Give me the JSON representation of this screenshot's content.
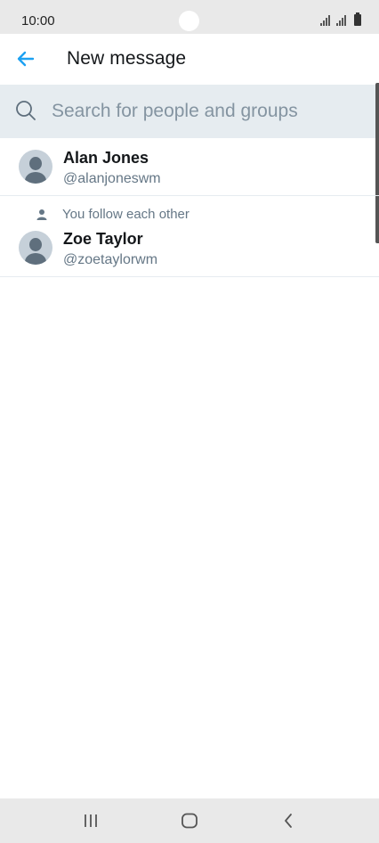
{
  "status_bar": {
    "time": "10:00",
    "icons": [
      "signal-icon",
      "signal-icon",
      "battery-icon"
    ]
  },
  "header": {
    "back_icon": "arrow-left-icon",
    "title": "New message",
    "accent_color": "#1da1f2"
  },
  "search": {
    "placeholder": "Search for people and groups",
    "value": "",
    "icon": "search-icon"
  },
  "people": [
    {
      "name": "Alan Jones",
      "handle": "@alanjoneswm",
      "note": ""
    },
    {
      "name": "Zoe Taylor",
      "handle": "@zoetaylorwm",
      "note": "You follow each other"
    }
  ],
  "nav_bar": {
    "buttons": [
      "recent-apps-icon",
      "home-icon",
      "back-icon"
    ]
  }
}
